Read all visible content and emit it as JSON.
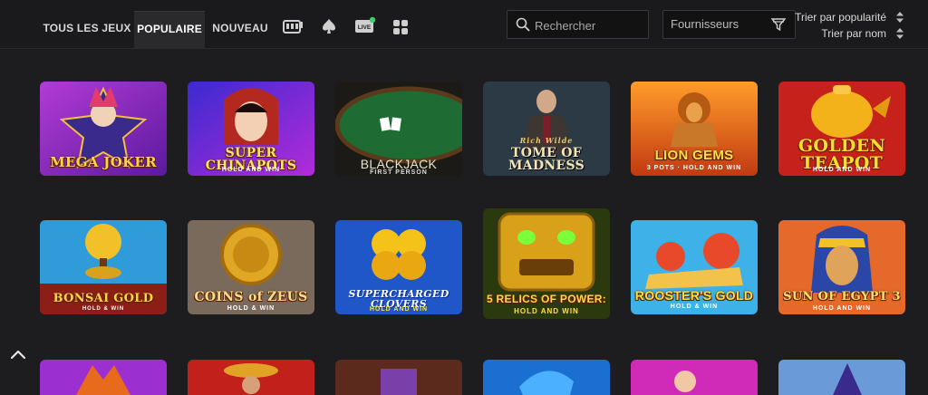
{
  "nav": {
    "tabs": [
      {
        "label": "TOUS LES JEUX"
      },
      {
        "label": "POPULAIRE"
      },
      {
        "label": "NOUVEAU"
      }
    ],
    "icon_live_label": "LIVE"
  },
  "search": {
    "placeholder": "Rechercher"
  },
  "providers": {
    "label": "Fournisseurs"
  },
  "sort": {
    "popularity": "Trier par popularité",
    "name": "Trier par nom"
  },
  "games": [
    {
      "name": "MEGA JOKER",
      "sub": ""
    },
    {
      "name": "SUPER CHINAPOTS",
      "sub": "HOLD AND WIN"
    },
    {
      "name": "BLACKJACK",
      "sub": "FIRST PERSON"
    },
    {
      "name": "TOME OF MADNESS",
      "sub": "Rich Wilde"
    },
    {
      "name": "LION GEMS",
      "sub": "3 POTS · HOLD AND WIN"
    },
    {
      "name": "GOLDEN TEAPOT",
      "sub": "HOLD AND WIN"
    },
    {
      "name": "BONSAI GOLD",
      "sub": "HOLD & WIN"
    },
    {
      "name": "COINS of ZEUS",
      "sub": "HOLD & WIN"
    },
    {
      "name": "SUPERCHARGED CLOVERS",
      "sub": "HOLD AND WIN"
    },
    {
      "name": "5 RELICS OF POWER:",
      "sub": "HOLD AND WIN"
    },
    {
      "name": "ROOSTER'S GOLD",
      "sub": "HOLD & WIN"
    },
    {
      "name": "SUN OF EGYPT 3",
      "sub": "HOLD AND WIN"
    }
  ],
  "colors": {
    "background": "#1d1d1f",
    "accent_gold": "#ffd34d",
    "live_dot": "#35d46a"
  }
}
